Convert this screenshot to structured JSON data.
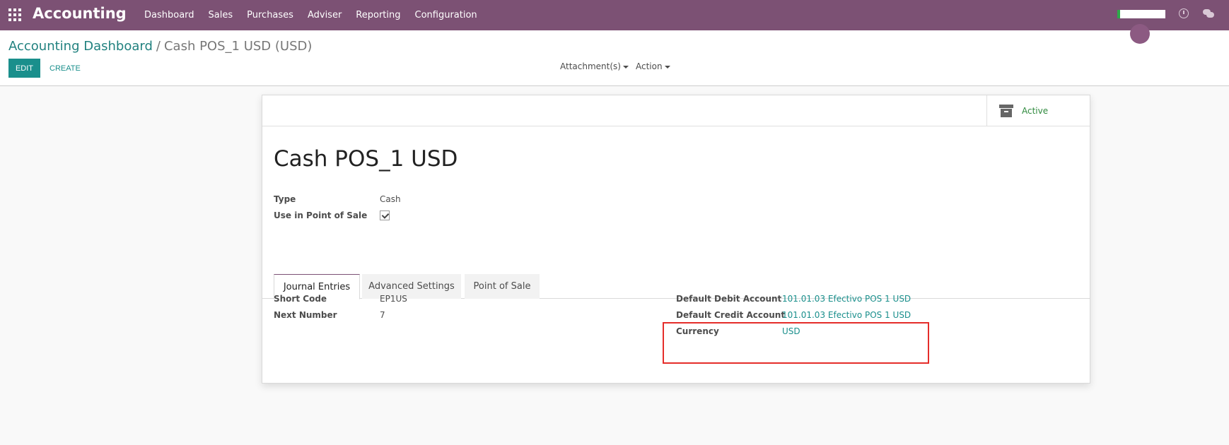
{
  "navbar": {
    "brand": "Accounting",
    "menu": [
      "Dashboard",
      "Sales",
      "Purchases",
      "Adviser",
      "Reporting",
      "Configuration"
    ]
  },
  "breadcrumb": {
    "parent": "Accounting Dashboard",
    "separator": "/",
    "current": "Cash POS_1 USD (USD)"
  },
  "buttons": {
    "edit": "EDIT",
    "create": "CREATE"
  },
  "sidebar": {
    "attachments": "Attachment(s)",
    "action": "Action"
  },
  "stat_button": {
    "label": "Active"
  },
  "record": {
    "name": "Cash POS_1 USD",
    "type_label": "Type",
    "type_value": "Cash",
    "pos_label": "Use in Point of Sale",
    "pos_checked": true
  },
  "tabs": [
    "Journal Entries",
    "Advanced Settings",
    "Point of Sale"
  ],
  "journal_entries": {
    "short_code_label": "Short Code",
    "short_code_value": "EP1US",
    "next_number_label": "Next Number",
    "next_number_value": "7",
    "debit_label": "Default Debit Account",
    "debit_value": "101.01.03 Efectivo POS 1 USD",
    "credit_label": "Default Credit Account",
    "credit_value": "101.01.03 Efectivo POS 1 USD",
    "currency_label": "Currency",
    "currency_value": "USD"
  },
  "colors": {
    "navbar": "#7c5174",
    "primary": "#1a8f8c",
    "highlight": "#e52d2a"
  }
}
